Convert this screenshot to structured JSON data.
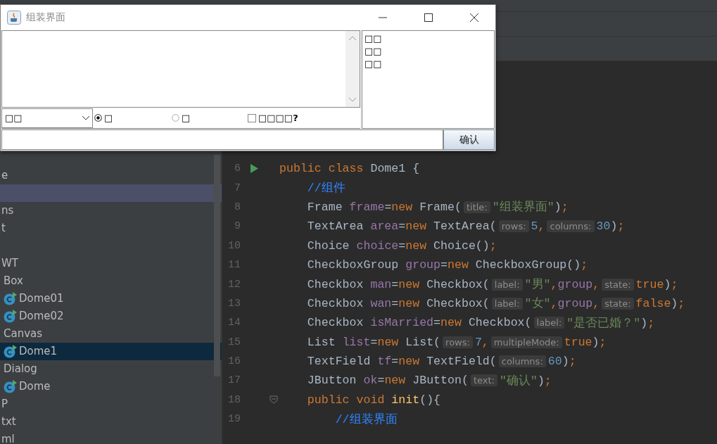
{
  "dialog": {
    "title": "组装界面",
    "choice": {
      "value": "□□"
    },
    "radios": [
      {
        "label": "□",
        "selected": true
      },
      {
        "label": "□",
        "selected": false
      }
    ],
    "checkbox": {
      "label": "□□□□?",
      "checked": false
    },
    "list": {
      "items": [
        "□□",
        "□□",
        "□□"
      ]
    },
    "button": "确认"
  },
  "project_tree": [
    {
      "label": "e",
      "selected": false,
      "hovered": false
    },
    {
      "selected": false,
      "hovered": true
    },
    {
      "label": "ns",
      "selected": false,
      "hovered": false
    },
    {
      "label": "t",
      "selected": false,
      "hovered": false
    },
    {
      "selected": false,
      "hovered": false
    },
    {
      "label": "WT",
      "selected": false,
      "hovered": false,
      "children": [
        {
          "label": "Box",
          "selected": false,
          "hovered": false,
          "children": [
            {
              "kind": "class",
              "label": "Dome01",
              "selected": false,
              "hovered": false
            },
            {
              "kind": "class",
              "label": "Dome02",
              "selected": false,
              "hovered": false
            }
          ]
        },
        {
          "label": "Canvas",
          "selected": false,
          "hovered": false,
          "children": [
            {
              "kind": "class",
              "label": "Dome1",
              "selected": true,
              "hovered": false
            }
          ]
        },
        {
          "label": "Dialog",
          "selected": false,
          "hovered": false,
          "children": [
            {
              "kind": "class",
              "label": "Dome",
              "selected": false,
              "hovered": false
            }
          ]
        }
      ]
    },
    {
      "label": "P",
      "selected": false,
      "hovered": false
    },
    {
      "label": "txt",
      "selected": false,
      "hovered": false
    },
    {
      "label": "ml",
      "selected": false,
      "hovered": false
    }
  ],
  "editor": {
    "lines": [
      {
        "number": "6",
        "kind": "run_marker",
        "tokens": [
          {
            "kind": "kw",
            "text": "public class "
          },
          {
            "kind": "plain",
            "text": "Dome1 {"
          }
        ]
      },
      {
        "number": "7",
        "tokens": [
          {
            "kind": "comment",
            "text": "    //组件"
          }
        ]
      },
      {
        "number": "8",
        "tokens": [
          {
            "kind": "plain",
            "text": "    Frame "
          },
          {
            "kind": "field",
            "text": "frame"
          },
          {
            "kind": "plain",
            "text": "="
          },
          {
            "kind": "kw",
            "text": "new "
          },
          {
            "kind": "plain",
            "text": "Frame("
          },
          {
            "kind": "hint",
            "text": "title:"
          },
          {
            "kind": "str",
            "text": "\"组装界面\""
          },
          {
            "kind": "plain",
            "text": ")"
          },
          {
            "kind": "kw",
            "text": ";"
          }
        ]
      },
      {
        "number": "9",
        "tokens": [
          {
            "kind": "plain",
            "text": "    TextArea "
          },
          {
            "kind": "field",
            "text": "area"
          },
          {
            "kind": "plain",
            "text": "="
          },
          {
            "kind": "kw",
            "text": "new "
          },
          {
            "kind": "plain",
            "text": "TextArea("
          },
          {
            "kind": "hint",
            "text": "rows:"
          },
          {
            "kind": "num",
            "text": "5"
          },
          {
            "kind": "kw",
            "text": ","
          },
          {
            "kind": "hint",
            "text": "columns:"
          },
          {
            "kind": "num",
            "text": "30"
          },
          {
            "kind": "plain",
            "text": ")"
          },
          {
            "kind": "kw",
            "text": ";"
          }
        ]
      },
      {
        "number": "10",
        "tokens": [
          {
            "kind": "plain",
            "text": "    Choice "
          },
          {
            "kind": "field",
            "text": "choice"
          },
          {
            "kind": "plain",
            "text": "="
          },
          {
            "kind": "kw",
            "text": "new "
          },
          {
            "kind": "plain",
            "text": "Choice()"
          },
          {
            "kind": "kw",
            "text": ";"
          }
        ]
      },
      {
        "number": "11",
        "tokens": [
          {
            "kind": "plain",
            "text": "    CheckboxGroup "
          },
          {
            "kind": "field",
            "text": "group"
          },
          {
            "kind": "plain",
            "text": "="
          },
          {
            "kind": "kw",
            "text": "new "
          },
          {
            "kind": "plain",
            "text": "CheckboxGroup()"
          },
          {
            "kind": "kw",
            "text": ";"
          }
        ]
      },
      {
        "number": "12",
        "tokens": [
          {
            "kind": "plain",
            "text": "    Checkbox "
          },
          {
            "kind": "field",
            "text": "man"
          },
          {
            "kind": "plain",
            "text": "="
          },
          {
            "kind": "kw",
            "text": "new "
          },
          {
            "kind": "plain",
            "text": "Checkbox("
          },
          {
            "kind": "hint",
            "text": "label:"
          },
          {
            "kind": "str",
            "text": "\"男\""
          },
          {
            "kind": "kw",
            "text": ","
          },
          {
            "kind": "field",
            "text": "group"
          },
          {
            "kind": "kw",
            "text": ","
          },
          {
            "kind": "hint",
            "text": "state:"
          },
          {
            "kind": "kw",
            "text": "true"
          },
          {
            "kind": "plain",
            "text": ")"
          },
          {
            "kind": "kw",
            "text": ";"
          }
        ]
      },
      {
        "number": "13",
        "tokens": [
          {
            "kind": "plain",
            "text": "    Checkbox "
          },
          {
            "kind": "field",
            "text": "wan"
          },
          {
            "kind": "plain",
            "text": "="
          },
          {
            "kind": "kw",
            "text": "new "
          },
          {
            "kind": "plain",
            "text": "Checkbox("
          },
          {
            "kind": "hint",
            "text": "label:"
          },
          {
            "kind": "str",
            "text": "\"女\""
          },
          {
            "kind": "kw",
            "text": ","
          },
          {
            "kind": "field",
            "text": "group"
          },
          {
            "kind": "kw",
            "text": ","
          },
          {
            "kind": "hint",
            "text": "state:"
          },
          {
            "kind": "kw",
            "text": "false"
          },
          {
            "kind": "plain",
            "text": ")"
          },
          {
            "kind": "kw",
            "text": ";"
          }
        ]
      },
      {
        "number": "14",
        "tokens": [
          {
            "kind": "plain",
            "text": "    Checkbox "
          },
          {
            "kind": "field",
            "text": "isMarried"
          },
          {
            "kind": "plain",
            "text": "="
          },
          {
            "kind": "kw",
            "text": "new "
          },
          {
            "kind": "plain",
            "text": "Checkbox("
          },
          {
            "kind": "hint",
            "text": "label:"
          },
          {
            "kind": "str",
            "text": "\"是否已婚？\""
          },
          {
            "kind": "plain",
            "text": ")"
          },
          {
            "kind": "kw",
            "text": ";"
          }
        ]
      },
      {
        "number": "15",
        "tokens": [
          {
            "kind": "plain",
            "text": "    List "
          },
          {
            "kind": "field",
            "text": "list"
          },
          {
            "kind": "plain",
            "text": "="
          },
          {
            "kind": "kw",
            "text": "new "
          },
          {
            "kind": "plain",
            "text": "List("
          },
          {
            "kind": "hint",
            "text": "rows:"
          },
          {
            "kind": "num",
            "text": "7"
          },
          {
            "kind": "kw",
            "text": ","
          },
          {
            "kind": "hint",
            "text": "multipleMode:"
          },
          {
            "kind": "kw",
            "text": "true"
          },
          {
            "kind": "plain",
            "text": ")"
          },
          {
            "kind": "kw",
            "text": ";"
          }
        ]
      },
      {
        "number": "16",
        "tokens": [
          {
            "kind": "plain",
            "text": "    TextField "
          },
          {
            "kind": "field",
            "text": "tf"
          },
          {
            "kind": "plain",
            "text": "="
          },
          {
            "kind": "kw",
            "text": "new "
          },
          {
            "kind": "plain",
            "text": "TextField("
          },
          {
            "kind": "hint",
            "text": "columns:"
          },
          {
            "kind": "num",
            "text": "60"
          },
          {
            "kind": "plain",
            "text": ")"
          },
          {
            "kind": "kw",
            "text": ";"
          }
        ]
      },
      {
        "number": "17",
        "tokens": [
          {
            "kind": "plain",
            "text": "    JButton "
          },
          {
            "kind": "field",
            "text": "ok"
          },
          {
            "kind": "plain",
            "text": "="
          },
          {
            "kind": "kw",
            "text": "new "
          },
          {
            "kind": "plain",
            "text": "JButton("
          },
          {
            "kind": "hint",
            "text": "text:"
          },
          {
            "kind": "str",
            "text": "\"确认\""
          },
          {
            "kind": "plain",
            "text": ")"
          },
          {
            "kind": "kw",
            "text": ";"
          }
        ]
      },
      {
        "number": "18",
        "kind": "fold_marker",
        "tokens": [
          {
            "kind": "kw",
            "text": "    public void "
          },
          {
            "kind": "method",
            "text": "init"
          },
          {
            "kind": "plain",
            "text": "(){"
          }
        ]
      },
      {
        "number": "19",
        "tokens": [
          {
            "kind": "comment",
            "text": "        //组装界面"
          }
        ]
      }
    ]
  }
}
